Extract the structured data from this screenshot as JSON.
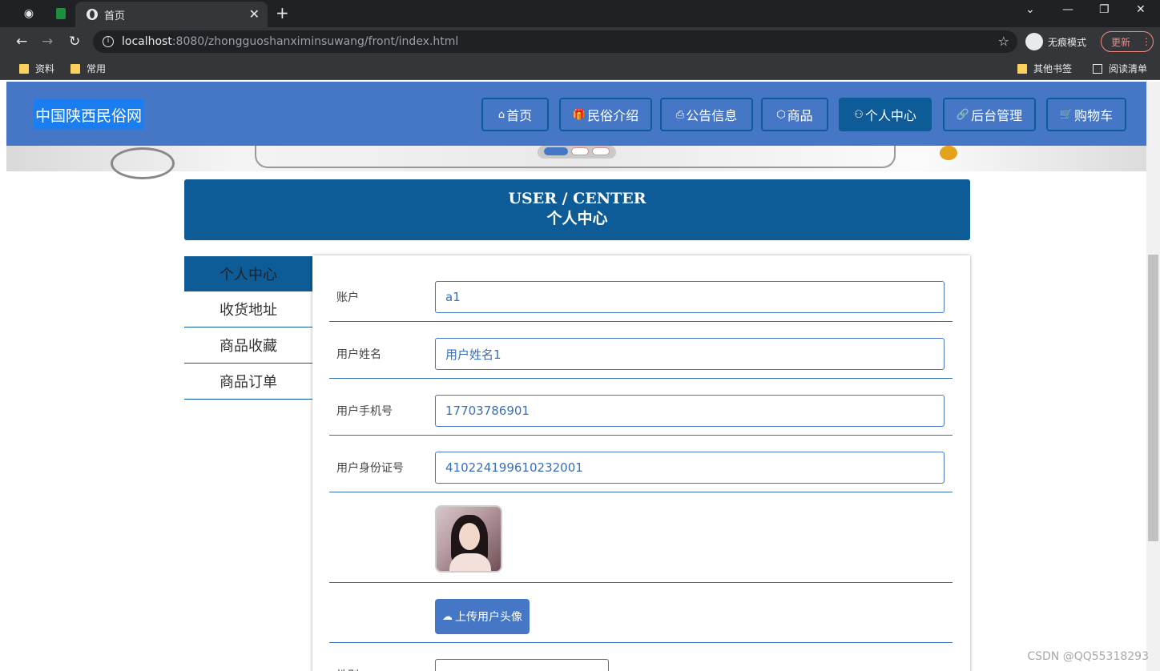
{
  "browser": {
    "tab_title": "首页",
    "url_host": "localhost",
    "url_rest": ":8080/zhongguoshanximinsuwang/front/index.html",
    "incognito_label": "无痕模式",
    "update_label": "更新",
    "bookmarks": [
      "资料",
      "常用"
    ],
    "bookmarks_right": [
      "其他书签",
      "阅读清单"
    ]
  },
  "site": {
    "logo": "中国陕西民俗网",
    "nav": [
      {
        "label": "首页",
        "icon": "home-icon"
      },
      {
        "label": "民俗介绍",
        "icon": "gift-icon"
      },
      {
        "label": "公告信息",
        "icon": "printer-icon"
      },
      {
        "label": "商品",
        "icon": "box-icon"
      },
      {
        "label": "个人中心",
        "icon": "user-icon"
      },
      {
        "label": "后台管理",
        "icon": "link-icon"
      },
      {
        "label": "购物车",
        "icon": "cart-icon"
      }
    ],
    "active_nav": "个人中心"
  },
  "page_title": {
    "en": "USER / CENTER",
    "cn": "个人中心"
  },
  "sidebar": {
    "items": [
      "个人中心",
      "收货地址",
      "商品收藏",
      "商品订单"
    ],
    "active": "个人中心"
  },
  "form": {
    "account_label": "账户",
    "account_value": "a1",
    "name_label": "用户姓名",
    "name_value": "用户姓名1",
    "phone_label": "用户手机号",
    "phone_value": "17703786901",
    "idcard_label": "用户身份证号",
    "idcard_value": "410224199610232001",
    "upload_label": "上传用户头像",
    "gender_label": "性别"
  },
  "watermark": "CSDN @QQ55318293",
  "colors": {
    "header": "#4677c7",
    "primary": "#0d5b97",
    "logo_bg": "#1b7ef0"
  }
}
